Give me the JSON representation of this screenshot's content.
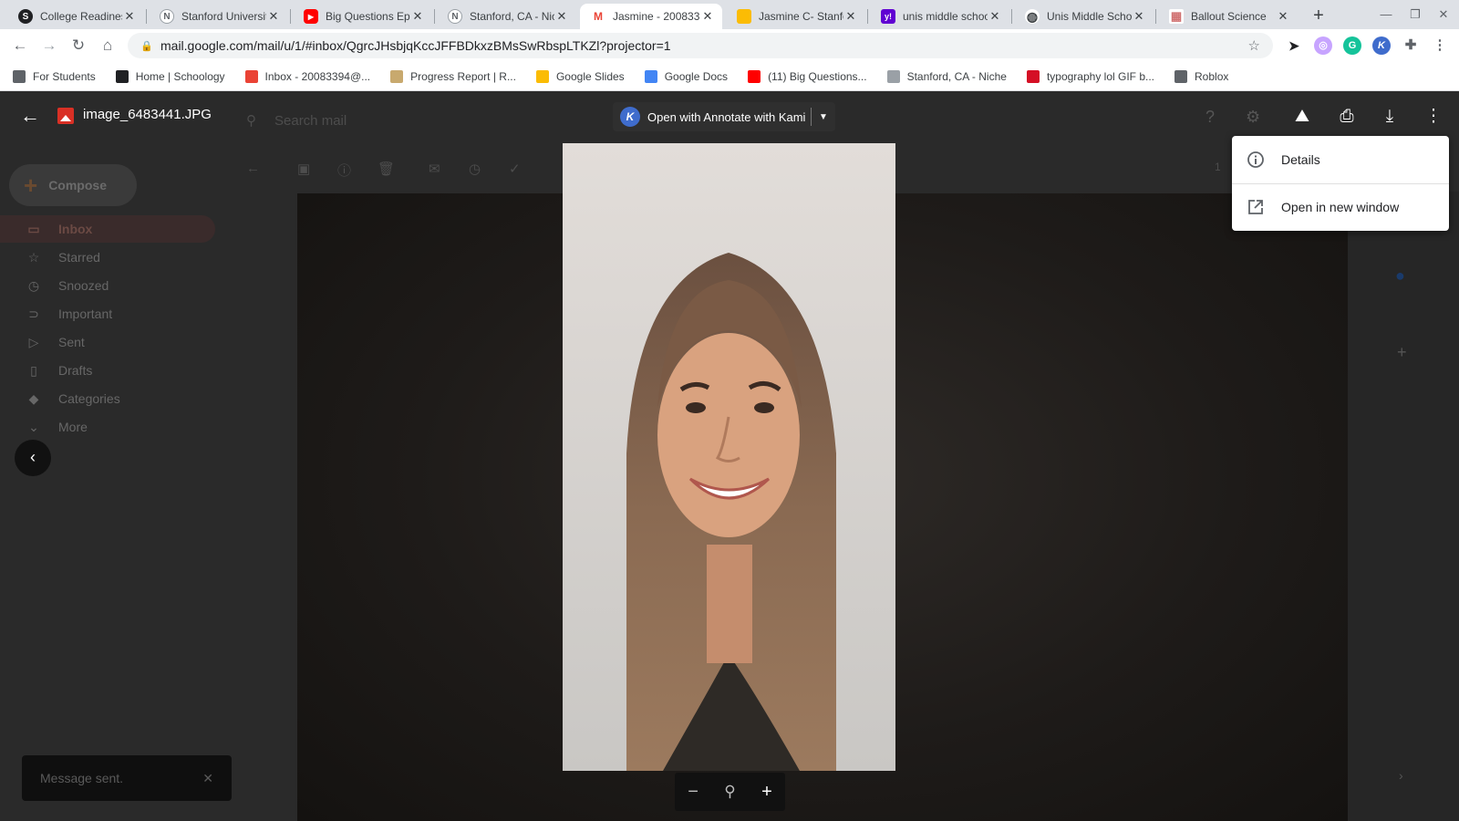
{
  "browser": {
    "tabs": [
      {
        "title": "College Readiness",
        "favicon": "schoology-icon",
        "color": "#202124",
        "letter": "S"
      },
      {
        "title": "Stanford University",
        "favicon": "niche-icon",
        "color": "#9aa0a6",
        "letter": "N"
      },
      {
        "title": "Big Questions Ep",
        "favicon": "youtube-icon",
        "color": "#ff0000",
        "letter": "▶"
      },
      {
        "title": "Stanford, CA - Niche",
        "favicon": "niche-icon",
        "color": "#9aa0a6",
        "letter": "N"
      },
      {
        "title": "Jasmine - 200833",
        "favicon": "gmail-icon",
        "color": "#ea4335",
        "letter": "M"
      },
      {
        "title": "Jasmine C- Stanford",
        "favicon": "google-slides-icon",
        "color": "#fbbc04",
        "letter": ""
      },
      {
        "title": "unis middle school",
        "favicon": "yahoo-icon",
        "color": "#6001d2",
        "letter": "y!"
      },
      {
        "title": "Unis Middle School",
        "favicon": "globe-icon",
        "color": "#3c4043",
        "letter": "◍"
      },
      {
        "title": "Ballout Science",
        "favicon": "grid-icon",
        "color": "#e8a0a0",
        "letter": "▦"
      }
    ],
    "new_tab": "+",
    "url": "mail.google.com/mail/u/1/#inbox/QgrcJHsbjqKccJFFBDkxzBMsSwRbspLTKZl?projector=1",
    "bookmarks": [
      {
        "label": "For Students",
        "icon": "student-icon",
        "color": "#5f6368"
      },
      {
        "label": "Home | Schoology",
        "icon": "schoology-icon",
        "color": "#202124"
      },
      {
        "label": "Inbox - 20083394@...",
        "icon": "gmail-icon",
        "color": "#ea4335"
      },
      {
        "label": "Progress Report | R...",
        "icon": "report-icon",
        "color": "#c8a96e"
      },
      {
        "label": "Google Slides",
        "icon": "google-slides-icon",
        "color": "#fbbc04"
      },
      {
        "label": "Google Docs",
        "icon": "google-docs-icon",
        "color": "#4285f4"
      },
      {
        "label": "(11) Big Questions...",
        "icon": "youtube-icon",
        "color": "#ff0000"
      },
      {
        "label": "Stanford, CA - Niche",
        "icon": "niche-icon",
        "color": "#9aa0a6"
      },
      {
        "label": "typography lol GIF b...",
        "icon": "gif-icon",
        "color": "#d50f25"
      },
      {
        "label": "Roblox",
        "icon": "roblox-icon",
        "color": "#5f6368"
      }
    ]
  },
  "gmail": {
    "search_placeholder": "Search mail",
    "compose": "Compose",
    "nav": [
      {
        "label": "Inbox",
        "icon": "inbox-icon",
        "glyph": "▭"
      },
      {
        "label": "Starred",
        "icon": "star-icon",
        "glyph": "☆"
      },
      {
        "label": "Snoozed",
        "icon": "clock-icon",
        "glyph": "◷"
      },
      {
        "label": "Important",
        "icon": "important-icon",
        "glyph": "⊃"
      },
      {
        "label": "Sent",
        "icon": "send-icon",
        "glyph": "▷"
      },
      {
        "label": "Drafts",
        "icon": "draft-icon",
        "glyph": "▯"
      },
      {
        "label": "Categories",
        "icon": "label-icon",
        "glyph": "◆"
      },
      {
        "label": "More",
        "icon": "chevron-down-icon",
        "glyph": "⌄"
      }
    ],
    "toast": "Message sent.",
    "page_count": "1"
  },
  "viewer": {
    "file_name": "image_6483441.JPG",
    "open_with": "Open with Annotate with Kami",
    "menu": [
      {
        "label": "Details",
        "icon": "info-icon"
      },
      {
        "label": "Open in new window",
        "icon": "open-new-window-icon"
      }
    ]
  },
  "colors": {
    "overlay": "#1f1f1f",
    "kami_blue": "#3f6ccc",
    "file_red": "#d93025"
  }
}
